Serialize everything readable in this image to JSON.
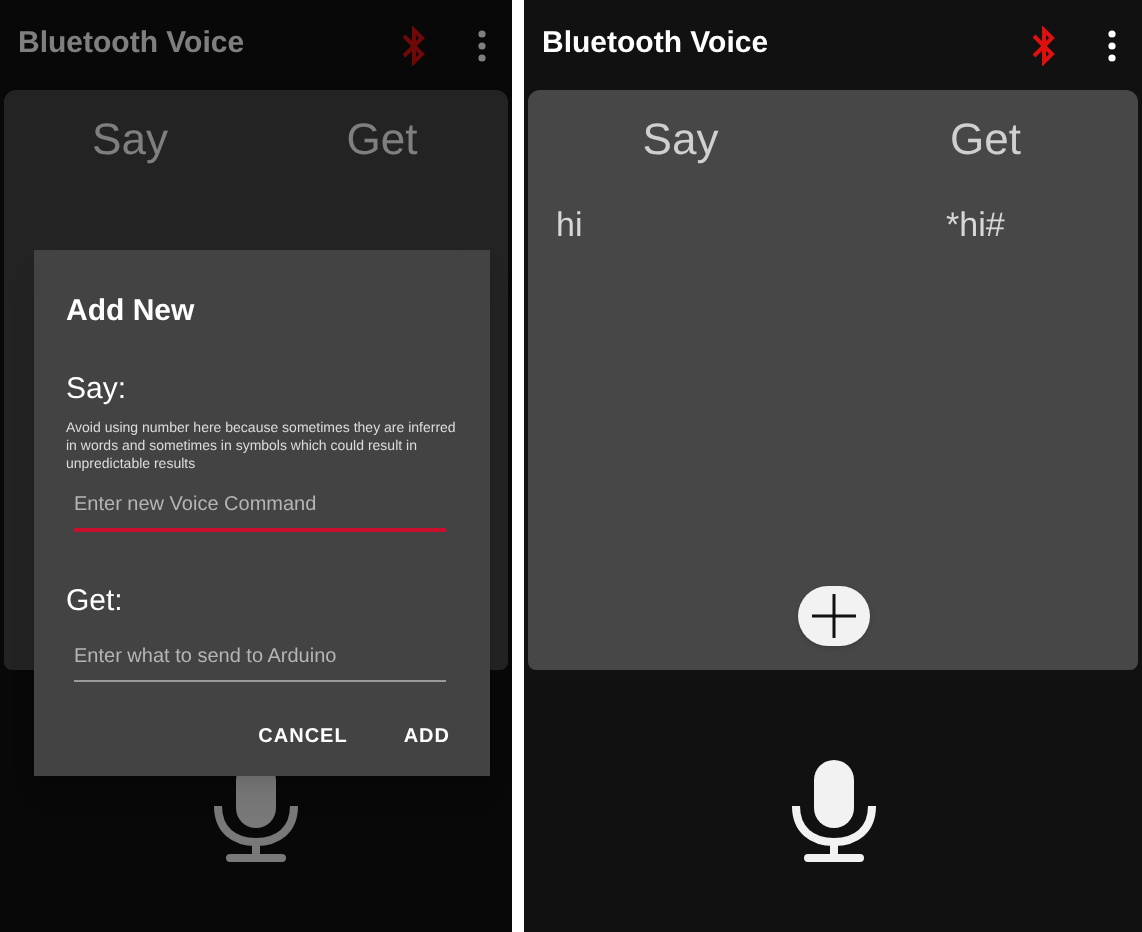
{
  "screens": [
    {
      "app_bar": {
        "title": "Bluetooth Voice"
      },
      "headers": [
        "Say",
        "Get"
      ],
      "dialog": {
        "title": "Add New",
        "fields": [
          {
            "label": "Say:",
            "hint": "Avoid using number here because sometimes they are inferred in words and sometimes in symbols which could result in unpredictable results",
            "placeholder": "Enter new Voice Command",
            "focused": true
          },
          {
            "label": "Get:",
            "placeholder": "Enter what to send to Arduino",
            "focused": false
          }
        ],
        "buttons": [
          "CANCEL",
          "ADD"
        ]
      }
    },
    {
      "app_bar": {
        "title": "Bluetooth Voice"
      },
      "headers": [
        "Say",
        "Get"
      ],
      "rows": [
        {
          "say": "hi",
          "get": "*hi#"
        }
      ]
    }
  ]
}
